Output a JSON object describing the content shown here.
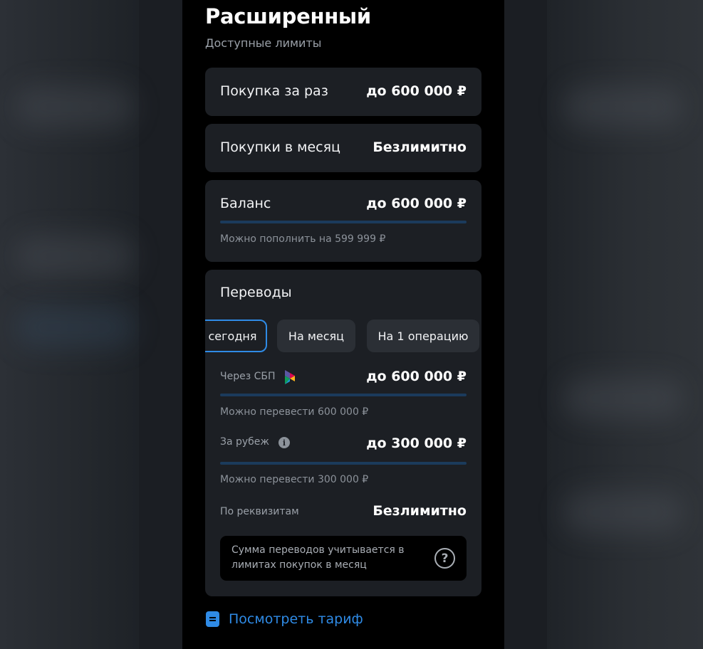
{
  "header": {
    "title": "Расширенный",
    "subtitle": "Доступные лимиты"
  },
  "limits": [
    {
      "label": "Покупка за раз",
      "value": "до 600 000 ₽"
    },
    {
      "label": "Покупки в месяц",
      "value": "Безлимитно"
    }
  ],
  "balance": {
    "label": "Баланс",
    "value": "до 600 000 ₽",
    "hint": "Можно пополнить на 599 999 ₽",
    "progress": 0.0
  },
  "transfers": {
    "title": "Переводы",
    "tabs": [
      {
        "label": "сегодня",
        "active": true
      },
      {
        "label": "На месяц",
        "active": false
      },
      {
        "label": "На 1 операцию",
        "active": false
      }
    ],
    "sbp": {
      "label": "Через СБП",
      "icon": "sbp-logo-icon",
      "value": "до 600 000 ₽",
      "hint": "Можно перевести 600 000 ₽",
      "progress": 0.0
    },
    "abroad": {
      "label": "За рубеж",
      "icon": "info-icon",
      "value": "до 300 000 ₽",
      "hint": "Можно перевести 300 000 ₽",
      "progress": 0.0
    },
    "requisites": {
      "label": "По реквизитам",
      "value": "Безлимитно"
    },
    "note": {
      "text": "Сумма переводов учитывается в лимитах покупок в месяц",
      "icon": "help-icon"
    }
  },
  "footer": {
    "tariff_link": "Посмотреть тариф",
    "icon": "document-icon"
  },
  "colors": {
    "accent": "#2f8be6",
    "card": "#1c1f24",
    "background": "#000000"
  }
}
